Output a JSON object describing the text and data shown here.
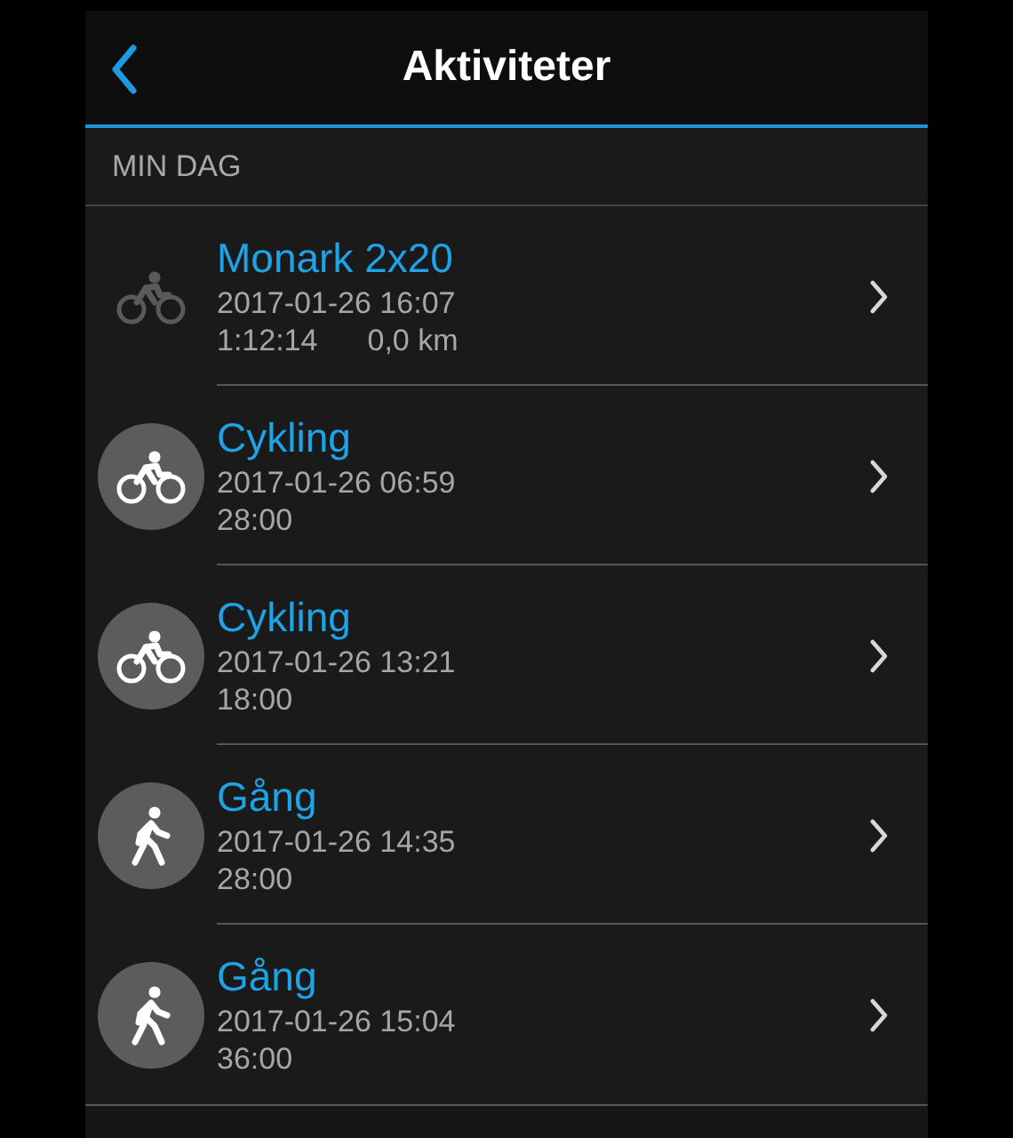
{
  "header": {
    "title": "Aktiviteter"
  },
  "section": {
    "title": "MIN DAG"
  },
  "activities": [
    {
      "kind": "cycling",
      "circled": false,
      "title": "Monark 2x20",
      "date": "2017-01-26 16:07",
      "stats": [
        "1:12:14",
        "0,0 km"
      ]
    },
    {
      "kind": "cycling",
      "circled": true,
      "title": "Cykling",
      "date": "2017-01-26 06:59",
      "stats": [
        "28:00"
      ]
    },
    {
      "kind": "cycling",
      "circled": true,
      "title": "Cykling",
      "date": "2017-01-26 13:21",
      "stats": [
        "18:00"
      ]
    },
    {
      "kind": "walking",
      "circled": true,
      "title": "Gång",
      "date": "2017-01-26 14:35",
      "stats": [
        "28:00"
      ]
    },
    {
      "kind": "walking",
      "circled": true,
      "title": "Gång",
      "date": "2017-01-26 15:04",
      "stats": [
        "36:00"
      ]
    }
  ]
}
